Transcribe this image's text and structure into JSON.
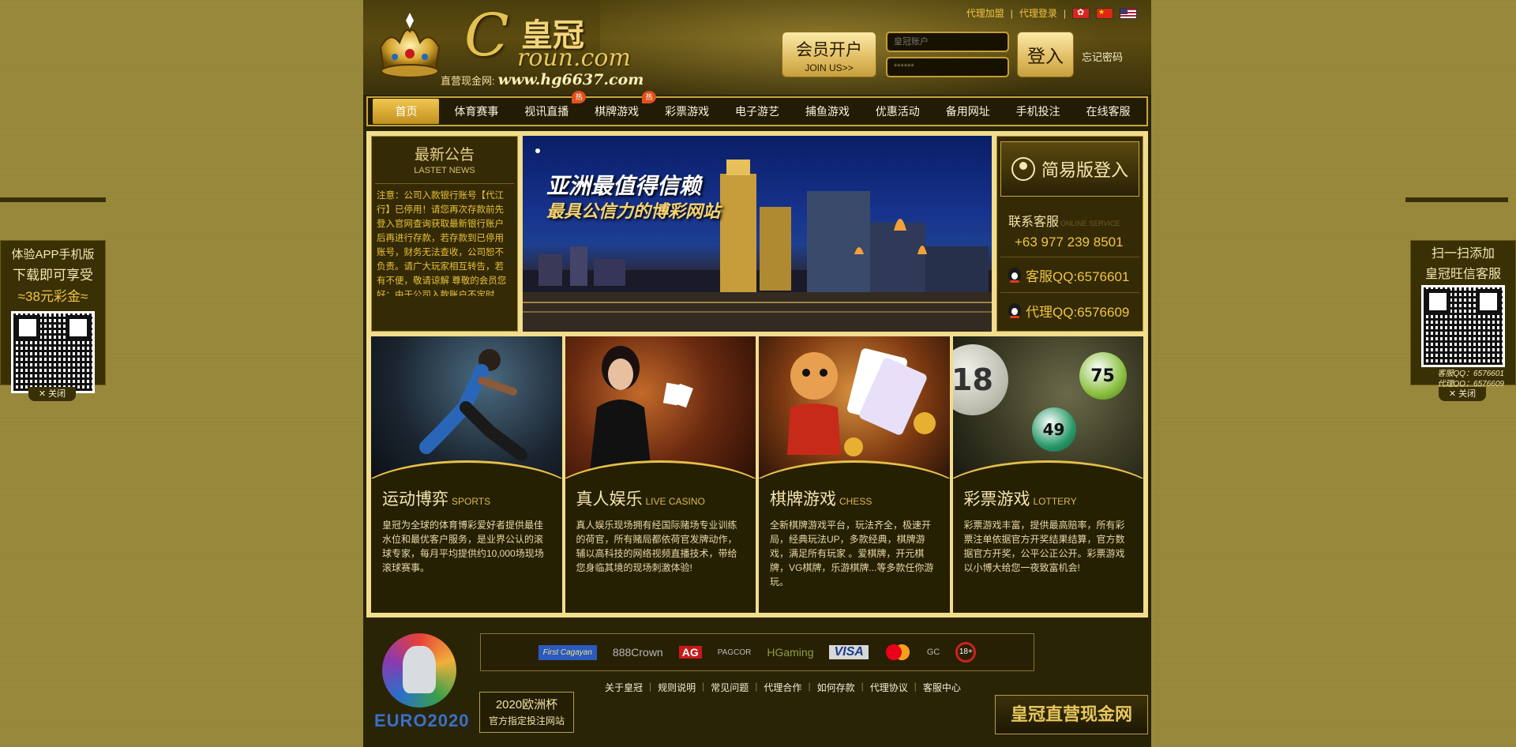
{
  "header": {
    "logo_c": "C",
    "logo_cn": "皇冠",
    "logo_en": "roun.com",
    "site_prefix": "直营现金网:",
    "site_url": "www.hg6637.com",
    "toplinks": [
      "代理加盟",
      "代理登录"
    ],
    "join": {
      "line1": "会员开户",
      "line2": "JOIN US>>"
    },
    "login": {
      "username_placeholder": "皇冠账户",
      "password_value": "******",
      "button": "登入",
      "forgot": "忘记密码"
    }
  },
  "nav": [
    {
      "label": "首页",
      "active": true
    },
    {
      "label": "体育赛事"
    },
    {
      "label": "视讯直播",
      "hot": "热"
    },
    {
      "label": "棋牌游戏",
      "hot": "热"
    },
    {
      "label": "彩票游戏"
    },
    {
      "label": "电子游艺"
    },
    {
      "label": "捕鱼游戏"
    },
    {
      "label": "优惠活动"
    },
    {
      "label": "备用网址"
    },
    {
      "label": "手机投注"
    },
    {
      "label": "在线客服"
    }
  ],
  "news": {
    "title": "最新公告",
    "subtitle": "LASTET NEWS",
    "body": "注意：公司入款银行账号【代江行】已停用！请您再次存款前先登入官网查询获取最新银行账户后再进行存款，若存款到已停用账号，财务无法查收，公司恕不负责。请广大玩家相互转告，若有不便，敬请谅解 尊敬的会员您好：由于公司入款账户不定时"
  },
  "banner": {
    "line1": "亚洲最值得信赖",
    "line2": "最具公信力的博彩网站"
  },
  "side": {
    "easy_login": "简易版登入",
    "contact_title": "联系客服",
    "contact_sub": "ONLINE SERVICE",
    "phone": "+63 977 239 8501",
    "qq_service": "客服QQ:6576601",
    "qq_agent": "代理QQ:6576609"
  },
  "cards": [
    {
      "title": "运动博弈",
      "en": "SPORTS",
      "desc": "皇冠为全球的体育博彩爱好者提供最佳水位和最优客户服务，是业界公认的滚球专家，每月平均提供约10,000场现场滚球赛事。"
    },
    {
      "title": "真人娱乐",
      "en": "LIVE CASINO",
      "desc": "真人娱乐现场拥有经国际赌场专业训练的荷官，所有赌局都依荷官发牌动作，辅以高科技的网络视频直播技术，带给您身临其境的现场刺激体验!"
    },
    {
      "title": "棋牌游戏",
      "en": "CHESS",
      "desc": "全新棋牌游戏平台，玩法齐全，极速开局，经典玩法UP，多款经典，棋牌游戏，满足所有玩家 。爱棋牌，开元棋牌，VG棋牌，乐游棋牌...等多款任你游玩。"
    },
    {
      "title": "彩票游戏",
      "en": "LOTTERY",
      "desc": "彩票游戏丰富，提供最高赔率，所有彩票注单依据官方开奖结果结算，官方数据官方开奖，公平公正公开。彩票游戏以小博大给您一夜致富机会!"
    }
  ],
  "lottery_balls": [
    "18",
    "75",
    "49"
  ],
  "footer": {
    "euro_text": "EURO2020",
    "euro_badge": {
      "line1": "2020欧洲杯",
      "line2": "官方指定投注网站"
    },
    "partners": [
      "First Cagayan",
      "888Crown",
      "AG",
      "PAGCOR",
      "HGaming",
      "VISA",
      "MasterCard",
      "GC",
      "18+"
    ],
    "links": [
      "关于皇冠",
      "规则说明",
      "常见问题",
      "代理合作",
      "如何存款",
      "代理协议",
      "客服中心"
    ],
    "logo_text": "皇冠直营现金网"
  },
  "float_left": {
    "line1": "体验APP手机版",
    "line2": "下载即可享受",
    "line3": "≈38元彩金≈",
    "close": "✕ 关闭"
  },
  "float_right": {
    "line1": "扫一扫添加",
    "line2": "皇冠旺信客服",
    "qq1": "客服QQ：6576601",
    "qq2": "代理QQ：6576609",
    "close": "✕ 关闭"
  }
}
